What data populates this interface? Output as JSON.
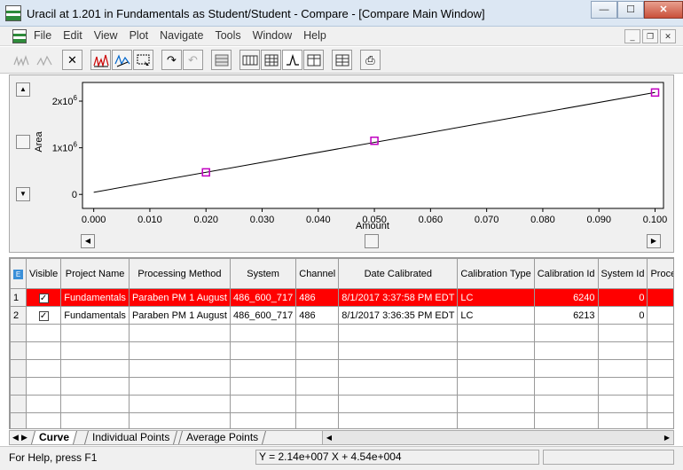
{
  "window": {
    "title": "Uracil at 1.201 in Fundamentals as Student/Student - Compare - [Compare Main Window]",
    "min_glyph": "—",
    "max_glyph": "☐",
    "close_glyph": "✕"
  },
  "menu": [
    "File",
    "Edit",
    "View",
    "Plot",
    "Navigate",
    "Tools",
    "Window",
    "Help"
  ],
  "mdi": {
    "min_glyph": "_",
    "restore_glyph": "❐",
    "close_glyph": "✕"
  },
  "toolbar": {
    "close_glyph": "✕",
    "redo_glyph": "↷",
    "undo_glyph": "↶",
    "print_glyph": "⎙"
  },
  "chart_data": {
    "type": "line",
    "title": "",
    "xlabel": "Amount",
    "ylabel": "Area",
    "xlim": [
      -0.002,
      0.1015
    ],
    "ylim": [
      -300000,
      2400000
    ],
    "x_ticks": [
      "0.000",
      "0.010",
      "0.020",
      "0.030",
      "0.040",
      "0.050",
      "0.060",
      "0.070",
      "0.080",
      "0.090",
      "0.100"
    ],
    "x_tick_values": [
      0,
      0.01,
      0.02,
      0.03,
      0.04,
      0.05,
      0.06,
      0.07,
      0.08,
      0.09,
      0.1
    ],
    "y_ticks": [
      {
        "value": 0,
        "base": "0",
        "exp": ""
      },
      {
        "value": 1000000,
        "base": "1x10",
        "exp": "6"
      },
      {
        "value": 2000000,
        "base": "2x10",
        "exp": "6"
      }
    ],
    "fit_line": {
      "x": [
        0,
        0.1
      ],
      "y": [
        45400,
        2185400
      ]
    },
    "points": [
      {
        "x": 0.02,
        "y": 473000
      },
      {
        "x": 0.05,
        "y": 1150000
      },
      {
        "x": 0.1,
        "y": 2185000
      }
    ],
    "point_color": "#c000c0",
    "line_color": "#000000"
  },
  "grid": {
    "columns": [
      "Visible",
      "Project Name",
      "Processing Method",
      "System",
      "Channel",
      "Date Calibrated",
      "Calibration Type",
      "Calibration Id",
      "System Id",
      "Proce"
    ],
    "check_glyph": "✓",
    "rows": [
      {
        "num": "1",
        "visible": true,
        "project": "Fundamentals",
        "method": "Paraben PM 1 August",
        "system": "486_600_717",
        "channel": "486",
        "date": "8/1/2017 3:37:58 PM EDT",
        "type": "LC",
        "cal_id": "6240",
        "sys_id": "0",
        "selected": true
      },
      {
        "num": "2",
        "visible": true,
        "project": "Fundamentals",
        "method": "Paraben PM 1 August",
        "system": "486_600_717",
        "channel": "486",
        "date": "8/1/2017 3:36:35 PM EDT",
        "type": "LC",
        "cal_id": "6213",
        "sys_id": "0",
        "selected": false
      }
    ],
    "empty_rows": 6,
    "selected_color": "#ff0000"
  },
  "tabs": [
    "Curve",
    "Individual Points",
    "Average Points"
  ],
  "status": {
    "help": "For Help, press F1",
    "equation": "Y = 2.14e+007 X + 4.54e+004"
  }
}
